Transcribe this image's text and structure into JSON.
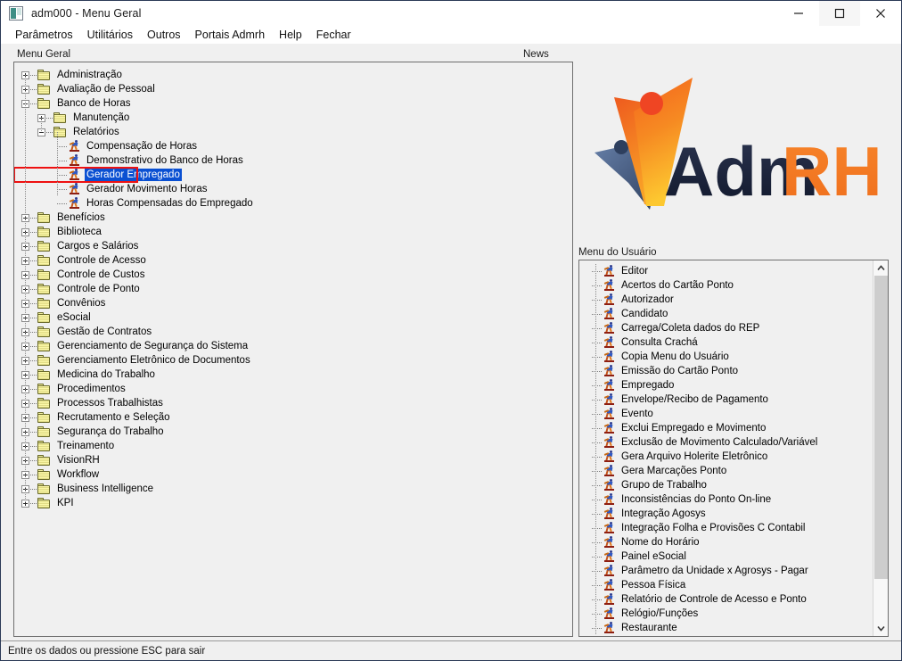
{
  "window": {
    "title": "adm000 - Menu Geral",
    "app_icon": "application-window-icon",
    "minimize_label": "minimize-icon",
    "maximize_label": "maximize-icon",
    "close_label": "close-icon"
  },
  "menubar": {
    "items": [
      {
        "label": "Parâmetros"
      },
      {
        "label": "Utilitários"
      },
      {
        "label": "Outros"
      },
      {
        "label": "Portais Admrh"
      },
      {
        "label": "Help"
      },
      {
        "label": "Fechar"
      }
    ]
  },
  "captions": {
    "menu_geral": "Menu Geral",
    "news": "News",
    "menu_do_usuario": "Menu do Usuário"
  },
  "logo": {
    "text_adm": "Adm",
    "text_rh": "RH",
    "color_orange": "#f47b20",
    "color_orange_light": "#fbb040",
    "color_navy": "#16213e",
    "color_blue_gray": "#3a4a6b",
    "color_red_dot": "#ef4523"
  },
  "tree": {
    "nodes": [
      {
        "label": "Administração",
        "depth": 0,
        "type": "folder",
        "state": "collapsed"
      },
      {
        "label": "Avaliação de Pessoal",
        "depth": 0,
        "type": "folder",
        "state": "collapsed"
      },
      {
        "label": "Banco de Horas",
        "depth": 0,
        "type": "folder",
        "state": "expanded"
      },
      {
        "label": "Manutenção",
        "depth": 1,
        "type": "folder",
        "state": "collapsed"
      },
      {
        "label": "Relatórios",
        "depth": 1,
        "type": "folder",
        "state": "expanded"
      },
      {
        "label": "Compensação de Horas",
        "depth": 2,
        "type": "leaf",
        "state": "none"
      },
      {
        "label": "Demonstrativo do Banco de Horas",
        "depth": 2,
        "type": "leaf",
        "state": "none"
      },
      {
        "label": "Gerador Empregado",
        "depth": 2,
        "type": "leaf",
        "state": "none",
        "selected": true,
        "highlight_box": true
      },
      {
        "label": "Gerador Movimento Horas",
        "depth": 2,
        "type": "leaf",
        "state": "none"
      },
      {
        "label": "Horas Compensadas do Empregado",
        "depth": 2,
        "type": "leaf",
        "state": "none"
      },
      {
        "label": "Benefícios",
        "depth": 0,
        "type": "folder",
        "state": "collapsed"
      },
      {
        "label": "Biblioteca",
        "depth": 0,
        "type": "folder",
        "state": "collapsed"
      },
      {
        "label": "Cargos e Salários",
        "depth": 0,
        "type": "folder",
        "state": "collapsed"
      },
      {
        "label": "Controle de Acesso",
        "depth": 0,
        "type": "folder",
        "state": "collapsed"
      },
      {
        "label": "Controle de Custos",
        "depth": 0,
        "type": "folder",
        "state": "collapsed"
      },
      {
        "label": "Controle de Ponto",
        "depth": 0,
        "type": "folder",
        "state": "collapsed"
      },
      {
        "label": "Convênios",
        "depth": 0,
        "type": "folder",
        "state": "collapsed"
      },
      {
        "label": "eSocial",
        "depth": 0,
        "type": "folder",
        "state": "collapsed"
      },
      {
        "label": "Gestão de Contratos",
        "depth": 0,
        "type": "folder",
        "state": "collapsed"
      },
      {
        "label": "Gerenciamento de Segurança do Sistema",
        "depth": 0,
        "type": "folder",
        "state": "collapsed"
      },
      {
        "label": "Gerenciamento Eletrônico de Documentos",
        "depth": 0,
        "type": "folder",
        "state": "collapsed"
      },
      {
        "label": "Medicina do Trabalho",
        "depth": 0,
        "type": "folder",
        "state": "collapsed"
      },
      {
        "label": "Procedimentos",
        "depth": 0,
        "type": "folder",
        "state": "collapsed"
      },
      {
        "label": "Processos Trabalhistas",
        "depth": 0,
        "type": "folder",
        "state": "collapsed"
      },
      {
        "label": "Recrutamento e Seleção",
        "depth": 0,
        "type": "folder",
        "state": "collapsed"
      },
      {
        "label": "Segurança do Trabalho",
        "depth": 0,
        "type": "folder",
        "state": "collapsed"
      },
      {
        "label": "Treinamento",
        "depth": 0,
        "type": "folder",
        "state": "collapsed"
      },
      {
        "label": "VisionRH",
        "depth": 0,
        "type": "folder",
        "state": "collapsed"
      },
      {
        "label": "Workflow",
        "depth": 0,
        "type": "folder",
        "state": "collapsed"
      },
      {
        "label": "Business Intelligence",
        "depth": 0,
        "type": "folder",
        "state": "collapsed"
      },
      {
        "label": "KPI",
        "depth": 0,
        "type": "folder",
        "state": "collapsed"
      }
    ]
  },
  "usermenu": {
    "items": [
      {
        "label": "Editor"
      },
      {
        "label": "Acertos do Cartão Ponto"
      },
      {
        "label": "Autorizador"
      },
      {
        "label": "Candidato"
      },
      {
        "label": "Carrega/Coleta dados do REP"
      },
      {
        "label": "Consulta Crachá"
      },
      {
        "label": "Copia Menu do Usuário"
      },
      {
        "label": "Emissão do Cartão Ponto"
      },
      {
        "label": "Empregado"
      },
      {
        "label": "Envelope/Recibo de Pagamento"
      },
      {
        "label": "Evento"
      },
      {
        "label": "Exclui Empregado e Movimento"
      },
      {
        "label": "Exclusão de Movimento Calculado/Variável"
      },
      {
        "label": "Gera Arquivo Holerite Eletrônico"
      },
      {
        "label": "Gera Marcações Ponto"
      },
      {
        "label": "Grupo de Trabalho"
      },
      {
        "label": "Inconsistências do Ponto On-line"
      },
      {
        "label": "Integração Agosys"
      },
      {
        "label": "Integração Folha e Provisões C Contabil"
      },
      {
        "label": "Nome do Horário"
      },
      {
        "label": "Painel eSocial"
      },
      {
        "label": "Parâmetro da Unidade x Agrosys - Pagar"
      },
      {
        "label": "Pessoa Física"
      },
      {
        "label": "Relatório de Controle de Acesso e Ponto"
      },
      {
        "label": "Relógio/Funções"
      },
      {
        "label": "Restaurante"
      }
    ],
    "scrollbar": {
      "up_arrow": "chevron-up-icon",
      "down_arrow": "chevron-down-icon"
    }
  },
  "statusbar": {
    "text": "Entre os dados ou pressione ESC para sair"
  },
  "colors": {
    "selection_blue": "#0a50d2",
    "highlight_red": "#ee1111",
    "window_bg": "#f0f0f0",
    "titlebar_bg": "#ffffff"
  }
}
